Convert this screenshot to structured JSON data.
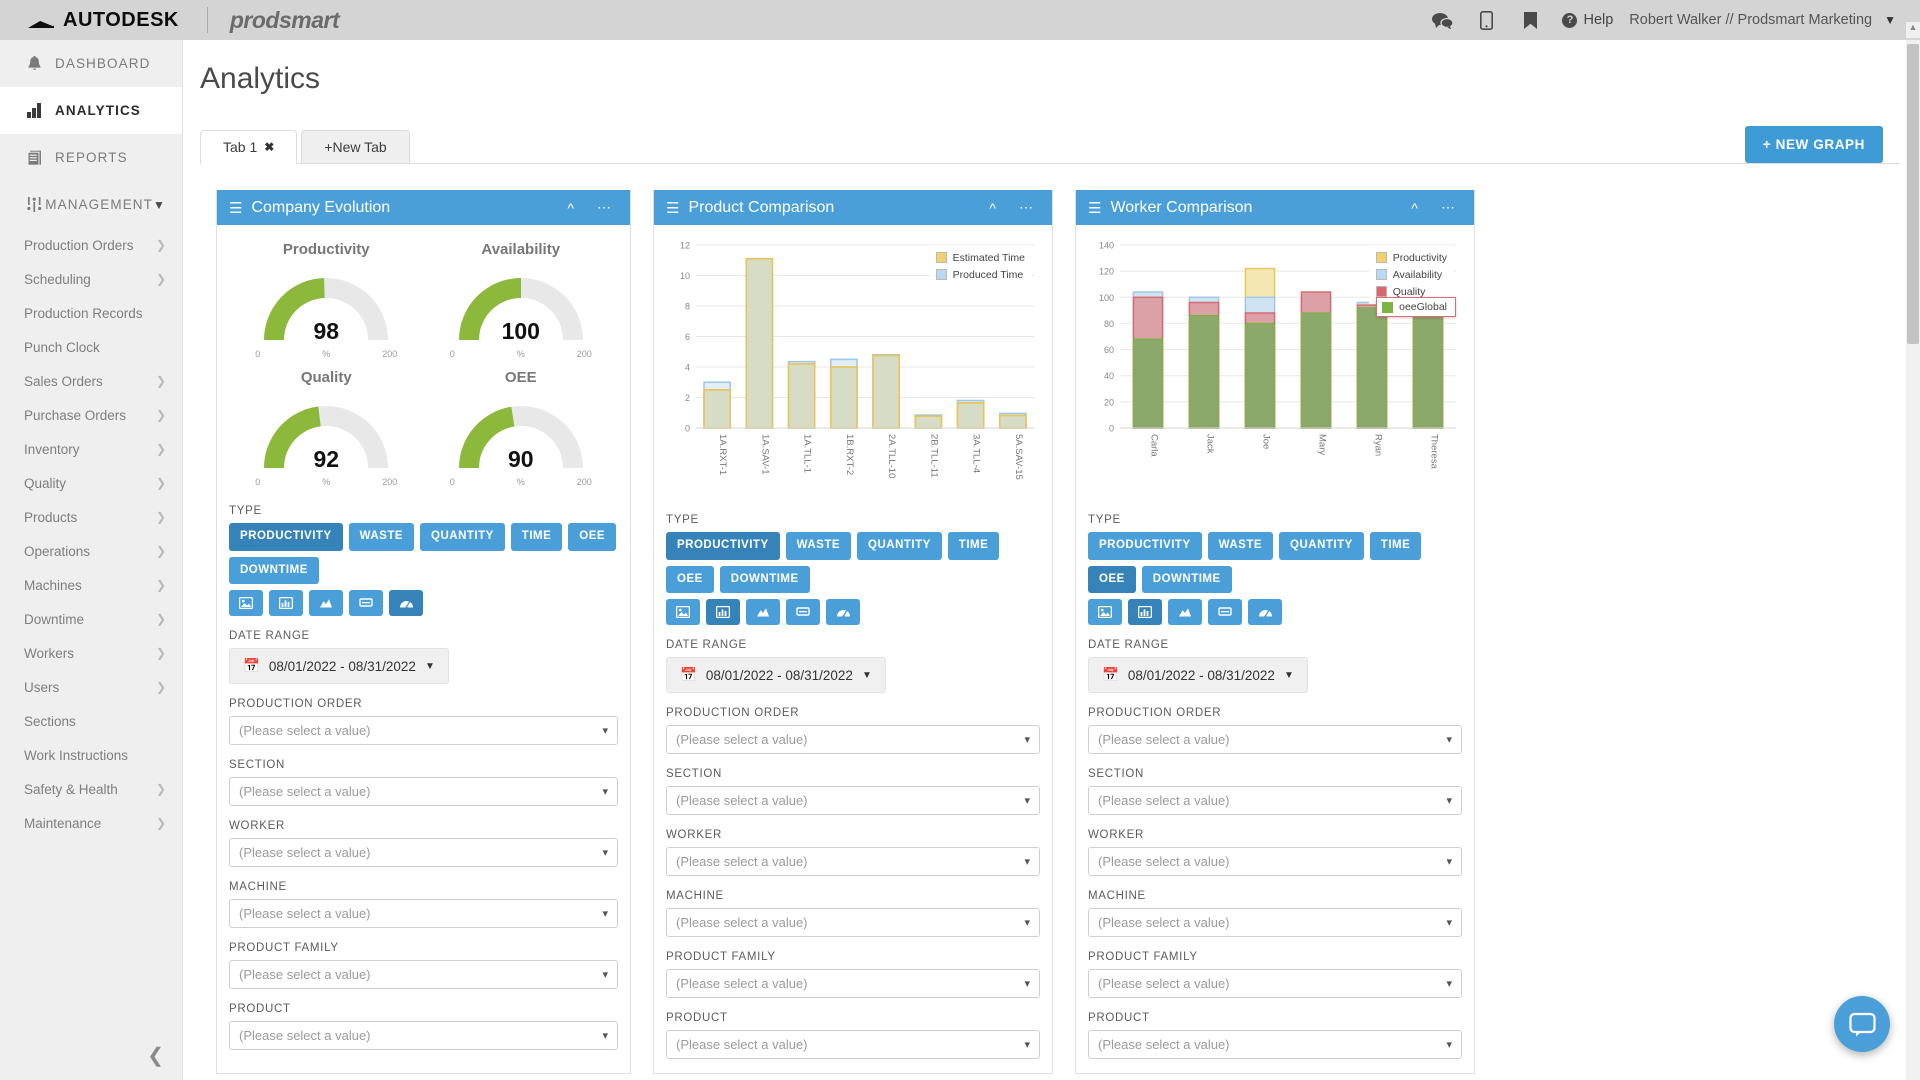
{
  "header": {
    "autodesk": "AUTODESK",
    "prodsmart": "prodsmart",
    "icons": [
      "chat-icon",
      "mobile-icon",
      "bookmark-icon"
    ],
    "help": "Help",
    "user": "Robert Walker // Prodsmart Marketing"
  },
  "sidebar": {
    "main_items": [
      {
        "label": "DASHBOARD",
        "icon": "bell-icon",
        "active": false
      },
      {
        "label": "ANALYTICS",
        "icon": "bar-chart-icon",
        "active": true
      },
      {
        "label": "REPORTS",
        "icon": "documents-icon",
        "active": false
      },
      {
        "label": "MANAGEMENT",
        "icon": "sliders-icon",
        "active": false,
        "chevron": "chevron-down-icon"
      }
    ],
    "sub_items": [
      {
        "label": "Production Orders",
        "arrow": true
      },
      {
        "label": "Scheduling",
        "arrow": true
      },
      {
        "label": "Production Records",
        "arrow": false
      },
      {
        "label": "Punch Clock",
        "arrow": false
      },
      {
        "label": "Sales Orders",
        "arrow": true
      },
      {
        "label": "Purchase Orders",
        "arrow": true
      },
      {
        "label": "Inventory",
        "arrow": true
      },
      {
        "label": "Quality",
        "arrow": true
      },
      {
        "label": "Products",
        "arrow": true
      },
      {
        "label": "Operations",
        "arrow": true
      },
      {
        "label": "Machines",
        "arrow": true
      },
      {
        "label": "Downtime",
        "arrow": true
      },
      {
        "label": "Workers",
        "arrow": true
      },
      {
        "label": "Users",
        "arrow": true
      },
      {
        "label": "Sections",
        "arrow": false
      },
      {
        "label": "Work Instructions",
        "arrow": false
      },
      {
        "label": "Safety & Health",
        "arrow": true
      },
      {
        "label": "Maintenance",
        "arrow": true
      }
    ],
    "collapse": "collapse-sidebar-icon"
  },
  "page": {
    "title": "Analytics",
    "tabs": [
      {
        "label": "Tab 1",
        "closable": true,
        "active": true
      },
      {
        "label": "+New Tab",
        "closable": false,
        "active": false
      }
    ],
    "new_graph": "+ NEW GRAPH"
  },
  "common": {
    "type_label": "TYPE",
    "type_chips": [
      "PRODUCTIVITY",
      "WASTE",
      "QUANTITY",
      "TIME",
      "OEE",
      "DOWNTIME"
    ],
    "icon_chips": [
      "image-icon",
      "bar-chart-icon",
      "area-chart-icon",
      "table-icon",
      "gauge-icon"
    ],
    "date_label": "DATE RANGE",
    "date_value": "08/01/2022 - 08/31/2022",
    "placeholder": "(Please select a value)",
    "fields": [
      "PRODUCTION ORDER",
      "SECTION",
      "WORKER",
      "MACHINE",
      "PRODUCT FAMILY",
      "PRODUCT"
    ]
  },
  "widgets": [
    {
      "title": "Company Evolution",
      "selected_type": "PRODUCTIVITY",
      "selected_icon": 4,
      "gauges": [
        {
          "label": "Productivity",
          "value": "98",
          "min": "0",
          "unit": "%",
          "max": "200",
          "pct": 49
        },
        {
          "label": "Availability",
          "value": "100",
          "min": "0",
          "unit": "%",
          "max": "200",
          "pct": 50
        },
        {
          "label": "Quality",
          "value": "92",
          "min": "0",
          "unit": "%",
          "max": "200",
          "pct": 46
        },
        {
          "label": "OEE",
          "value": "90",
          "min": "0",
          "unit": "%",
          "max": "200",
          "pct": 45
        }
      ]
    },
    {
      "title": "Product Comparison",
      "selected_type": "PRODUCTIVITY",
      "selected_icon": 1
    },
    {
      "title": "Worker Comparison",
      "selected_type": "OEE",
      "selected_icon": 1
    }
  ],
  "chart_data": [
    {
      "type": "bar",
      "title": "Product Comparison",
      "categories": [
        "1A.RXT-1",
        "1A.SAV-1",
        "1A.TLL-1",
        "1B.RXT-2",
        "2A.TLL-10",
        "2B.TLL-11",
        "3A.TLL-4",
        "5A.SAV-15"
      ],
      "series": [
        {
          "name": "Estimated Time",
          "color": "#f2d06b",
          "values": [
            2.5,
            11.1,
            4.2,
            4.0,
            4.75,
            0.78,
            1.65,
            0.82
          ]
        },
        {
          "name": "Produced Time",
          "color": "#b9d8f2",
          "values": [
            3.0,
            9.75,
            4.35,
            4.5,
            4.8,
            0.85,
            1.8,
            0.95
          ]
        }
      ],
      "ylim": [
        0,
        12
      ],
      "yticks": [
        0,
        2,
        4,
        6,
        8,
        10,
        12
      ],
      "xlabel": "",
      "ylabel": "",
      "grid": true,
      "legend_position": "top-right"
    },
    {
      "type": "bar",
      "title": "Worker Comparison",
      "categories": [
        "Carla",
        "Jack",
        "Joe",
        "Mary",
        "Ryan",
        "Theresa"
      ],
      "series": [
        {
          "name": "Productivity",
          "color": "#f2d06b",
          "values": [
            104,
            100,
            122,
            104,
            96,
            96
          ]
        },
        {
          "name": "Availability",
          "color": "#b9d8f2",
          "values": [
            104,
            100,
            100,
            100,
            96,
            96
          ]
        },
        {
          "name": "Quality",
          "color": "#d9676e",
          "values": [
            100,
            96,
            88,
            104,
            94,
            94
          ]
        },
        {
          "name": "oeeGlobal",
          "color": "#7cb342",
          "values": [
            68,
            86,
            80,
            88,
            92,
            86
          ]
        }
      ],
      "ylim": [
        0,
        140
      ],
      "yticks": [
        0,
        20,
        40,
        60,
        80,
        100,
        120,
        140
      ],
      "xlabel": "",
      "ylabel": "",
      "grid": true,
      "legend_position": "top-right",
      "tooltip": "oeeGlobal"
    }
  ],
  "colors": {
    "accent": "#4a9fd8",
    "accent_dark": "#3583b8",
    "gauge_green": "#8cb93c",
    "gauge_track": "#e8e8e8"
  },
  "chat_fab": "chat-support-icon"
}
